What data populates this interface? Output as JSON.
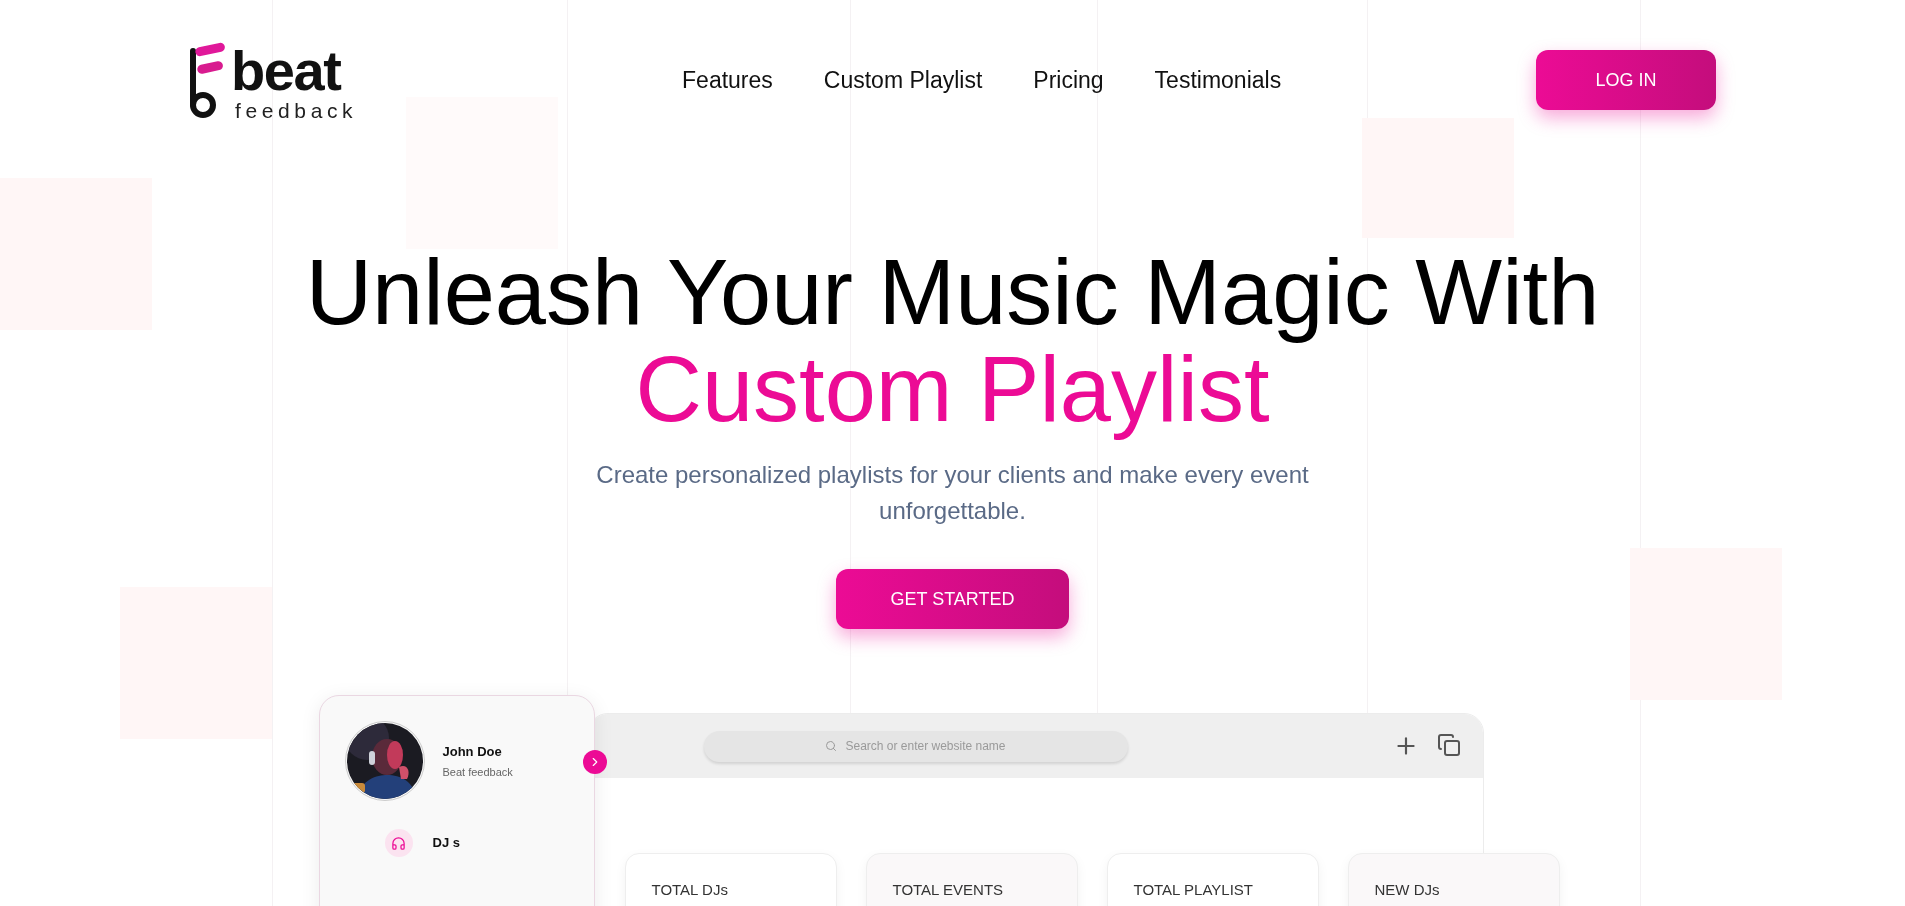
{
  "logo": {
    "word": "beat",
    "tagline": "feedback"
  },
  "nav": [
    "Features",
    "Custom Playlist",
    "Pricing",
    "Testimonials"
  ],
  "login_button": "LOG IN",
  "hero": {
    "title": "Unleash Your Music Magic With",
    "highlight": "Custom Playlist",
    "subtitle": "Create personalized playlists for your clients and make every event unforgettable.",
    "cta": "GET STARTED"
  },
  "mockup": {
    "profile": {
      "name": "John Doe",
      "role": "Beat feedback"
    },
    "sidebar_items": [
      {
        "label": "DJ s"
      }
    ],
    "search": {
      "placeholder": "Search or enter website name"
    },
    "stats": [
      {
        "label": "TOTAL DJs"
      },
      {
        "label": "TOTAL EVENTS"
      },
      {
        "label": "TOTAL PLAYLIST"
      },
      {
        "label": "NEW DJs"
      }
    ]
  }
}
